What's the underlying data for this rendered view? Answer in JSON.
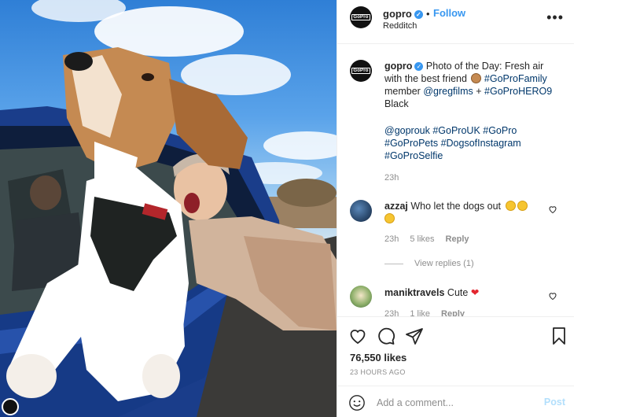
{
  "header": {
    "username": "gopro",
    "logo_text": "GoPro",
    "separator": "•",
    "follow_label": "Follow",
    "location": "Redditch",
    "more_icon": "more-horizontal-icon",
    "more_glyph": "•••"
  },
  "caption": {
    "username": "gopro",
    "text_part1": "Photo of the Day: Fresh air with the best friend",
    "tag1": "#GoProFamily",
    "text_member": "member",
    "mention": "@gregfilms",
    "plus": "+",
    "tag2": "#GoProHERO9",
    "text_black": "Black",
    "tags_line": "@goprouk #GoProUK #GoPro #GoProPets #DogsofInstagram #GoProSelfie",
    "time": "23h"
  },
  "comments": [
    {
      "username": "azzaj",
      "text": "Who let the dogs out",
      "time": "23h",
      "likes": "5 likes",
      "reply": "Reply"
    },
    {
      "username": "maniktravels",
      "text": "Cute",
      "time": "23h",
      "likes": "1 like",
      "reply": "Reply"
    }
  ],
  "view_replies": "View replies (1)",
  "actions": {
    "likes": "76,550 likes",
    "time_ago": "23 HOURS AGO",
    "icons": [
      "heart-icon",
      "comment-icon",
      "share-icon",
      "bookmark-icon"
    ]
  },
  "add_comment": {
    "placeholder": "Add a comment...",
    "post_label": "Post"
  },
  "colors": {
    "accent": "#3897f0",
    "hashtag": "#00376b",
    "muted": "#8e8e8e",
    "post_disabled": "#b2dffc"
  }
}
